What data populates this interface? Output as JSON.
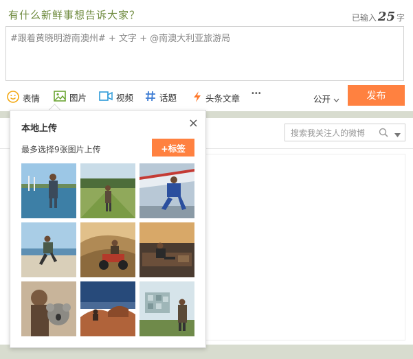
{
  "composer": {
    "prompt": "有什么新鲜事想告诉大家？",
    "counter_prefix": "已输入",
    "counter_value": "25",
    "counter_suffix": "字",
    "text_value": "#跟着黄晓明游南澳州#  + 文字 + @南澳大利亚旅游局"
  },
  "toolbar": {
    "items": [
      {
        "label": "表情",
        "icon": "smile-icon"
      },
      {
        "label": "图片",
        "icon": "image-icon"
      },
      {
        "label": "视频",
        "icon": "video-icon"
      },
      {
        "label": "话题",
        "icon": "hashtag-icon"
      },
      {
        "label": "头条文章",
        "icon": "lightning-icon"
      }
    ],
    "more_label": "•••",
    "visibility": "公开",
    "publish_label": "发布"
  },
  "feed": {
    "search_placeholder": "搜索我关注人的微博"
  },
  "upload_popover": {
    "title": "本地上传",
    "subtitle": "最多选择9张图片上传",
    "tag_button": "+标签",
    "close": "×",
    "thumbnails": [
      {
        "subject": "man in overalls standing in water"
      },
      {
        "subject": "man walking in vineyard"
      },
      {
        "subject": "man in blue flight suit with airplane"
      },
      {
        "subject": "man running on beach"
      },
      {
        "subject": "man on quad bike in dunes"
      },
      {
        "subject": "man sitting in lounge chair"
      },
      {
        "subject": "man holding koala"
      },
      {
        "subject": "man on rocks at sunset"
      },
      {
        "subject": "man standing by cube building"
      }
    ]
  },
  "colors": {
    "accent": "#ff8140",
    "prompt_green": "#6f8b3f",
    "background": "#d8dccf"
  }
}
